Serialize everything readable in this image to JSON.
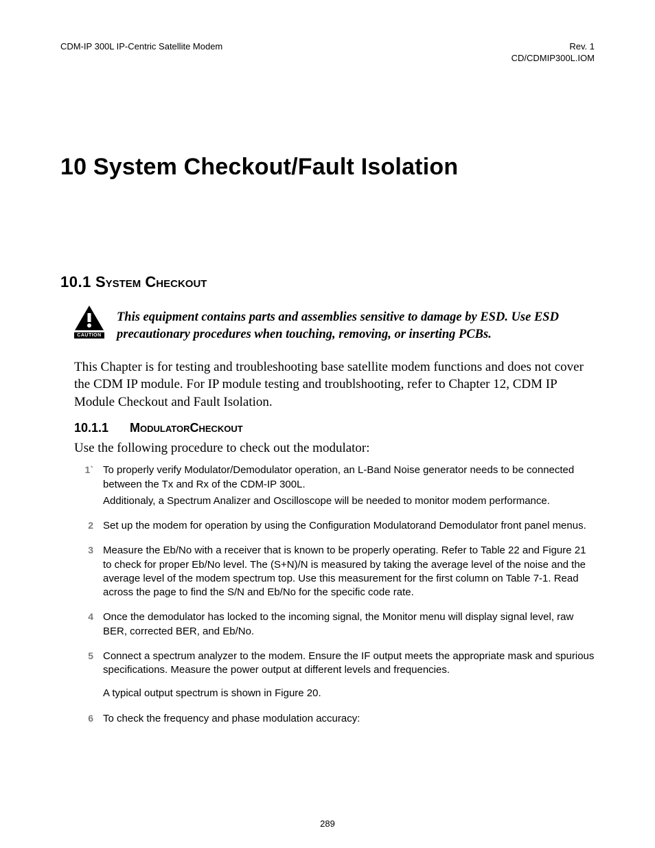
{
  "header": {
    "left": "CDM-IP 300L IP-Centric Satellite Modem",
    "right_line1": "Rev. 1",
    "right_line2": "CD/CDMIP300L.IOM"
  },
  "chapter": {
    "number": "10",
    "title": "System Checkout/Fault Isolation"
  },
  "section": {
    "number": "10.1",
    "title_caps": "System Checkout"
  },
  "caution": {
    "label": "CAUTION",
    "icon_name": "caution-icon",
    "text": "This equipment contains parts and assemblies sensitive to damage by ESD. Use ESD precautionary procedures when touching, removing, or inserting PCBs."
  },
  "intro_paragraph": "This Chapter is for testing and troubleshooting base satellite modem functions and does not cover the CDM IP module. For IP module testing and troublshooting, refer to Chapter 12, CDM IP Module Checkout and Fault Isolation.",
  "subsection": {
    "number": "10.1.1",
    "title_caps": "ModulatorCheckout",
    "lead": "Use the following procedure to check out the modulator:"
  },
  "steps": [
    {
      "num": "1`",
      "paras": [
        "To properly verify Modulator/Demodulator operation, an L-Band Noise generator needs to be connected between the Tx and Rx of the CDM-IP 300L.",
        "Additionaly, a Spectrum Analizer and Oscilloscope will be needed to monitor modem performance."
      ]
    },
    {
      "num": "2",
      "paras": [
        "Set up the modem for operation by using the Configuration Modulatorand Demodulator front panel menus."
      ]
    },
    {
      "num": "3",
      "paras": [
        "Measure the Eb/No with a receiver that is known to be properly operating. Refer to Table 22 and Figure 21 to check for proper Eb/No level. The (S+N)/N is measured by taking the average level of the noise and the average level of the modem spectrum top. Use this measurement for the first column on Table 7-1. Read across the page to find the S/N and Eb/No for the specific code rate."
      ]
    },
    {
      "num": "4",
      "paras": [
        "Once the demodulator has locked to the incoming signal, the Monitor menu will display signal level, raw BER, corrected BER, and Eb/No."
      ]
    },
    {
      "num": "5",
      "paras": [
        "Connect a spectrum analyzer to the modem. Ensure the IF output meets the appropriate mask and spurious specifications. Measure the power output at different levels and frequencies.",
        "A typical output spectrum is shown in Figure 20."
      ]
    },
    {
      "num": "6",
      "paras": [
        "To check the frequency and phase modulation accuracy:"
      ]
    }
  ],
  "page_number": "289"
}
